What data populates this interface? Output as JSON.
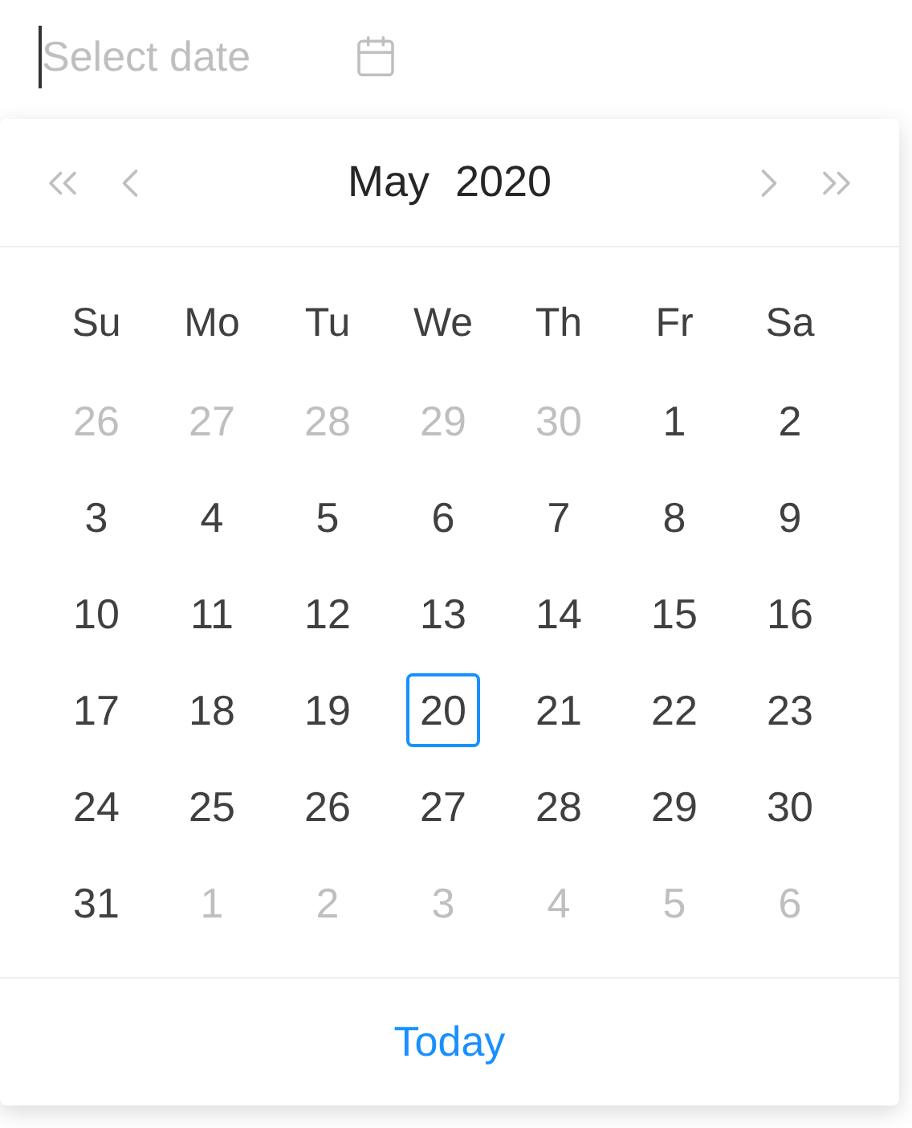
{
  "input": {
    "placeholder": "Select date"
  },
  "header": {
    "month": "May",
    "year": "2020"
  },
  "weekdays": [
    "Su",
    "Mo",
    "Tu",
    "We",
    "Th",
    "Fr",
    "Sa"
  ],
  "weeks": [
    [
      {
        "text": "26",
        "in_month": false,
        "today": false
      },
      {
        "text": "27",
        "in_month": false,
        "today": false
      },
      {
        "text": "28",
        "in_month": false,
        "today": false
      },
      {
        "text": "29",
        "in_month": false,
        "today": false
      },
      {
        "text": "30",
        "in_month": false,
        "today": false
      },
      {
        "text": "1",
        "in_month": true,
        "today": false
      },
      {
        "text": "2",
        "in_month": true,
        "today": false
      }
    ],
    [
      {
        "text": "3",
        "in_month": true,
        "today": false
      },
      {
        "text": "4",
        "in_month": true,
        "today": false
      },
      {
        "text": "5",
        "in_month": true,
        "today": false
      },
      {
        "text": "6",
        "in_month": true,
        "today": false
      },
      {
        "text": "7",
        "in_month": true,
        "today": false
      },
      {
        "text": "8",
        "in_month": true,
        "today": false
      },
      {
        "text": "9",
        "in_month": true,
        "today": false
      }
    ],
    [
      {
        "text": "10",
        "in_month": true,
        "today": false
      },
      {
        "text": "11",
        "in_month": true,
        "today": false
      },
      {
        "text": "12",
        "in_month": true,
        "today": false
      },
      {
        "text": "13",
        "in_month": true,
        "today": false
      },
      {
        "text": "14",
        "in_month": true,
        "today": false
      },
      {
        "text": "15",
        "in_month": true,
        "today": false
      },
      {
        "text": "16",
        "in_month": true,
        "today": false
      }
    ],
    [
      {
        "text": "17",
        "in_month": true,
        "today": false
      },
      {
        "text": "18",
        "in_month": true,
        "today": false
      },
      {
        "text": "19",
        "in_month": true,
        "today": false
      },
      {
        "text": "20",
        "in_month": true,
        "today": true
      },
      {
        "text": "21",
        "in_month": true,
        "today": false
      },
      {
        "text": "22",
        "in_month": true,
        "today": false
      },
      {
        "text": "23",
        "in_month": true,
        "today": false
      }
    ],
    [
      {
        "text": "24",
        "in_month": true,
        "today": false
      },
      {
        "text": "25",
        "in_month": true,
        "today": false
      },
      {
        "text": "26",
        "in_month": true,
        "today": false
      },
      {
        "text": "27",
        "in_month": true,
        "today": false
      },
      {
        "text": "28",
        "in_month": true,
        "today": false
      },
      {
        "text": "29",
        "in_month": true,
        "today": false
      },
      {
        "text": "30",
        "in_month": true,
        "today": false
      }
    ],
    [
      {
        "text": "31",
        "in_month": true,
        "today": false
      },
      {
        "text": "1",
        "in_month": false,
        "today": false
      },
      {
        "text": "2",
        "in_month": false,
        "today": false
      },
      {
        "text": "3",
        "in_month": false,
        "today": false
      },
      {
        "text": "4",
        "in_month": false,
        "today": false
      },
      {
        "text": "5",
        "in_month": false,
        "today": false
      },
      {
        "text": "6",
        "in_month": false,
        "today": false
      }
    ]
  ],
  "footer": {
    "today_link": "Today"
  }
}
